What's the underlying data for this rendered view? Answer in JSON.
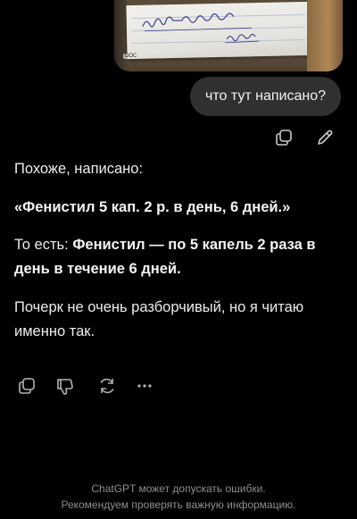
{
  "attachment": {
    "type": "image",
    "handwriting": [
      "Фенистил 5 кап 2 р. в день",
      "6 дней"
    ],
    "badge": "DOC"
  },
  "user_message": {
    "text": "что тут написано?"
  },
  "user_actions": [
    {
      "icon": "copy-icon"
    },
    {
      "icon": "edit-icon"
    }
  ],
  "assistant_message": {
    "intro": "Похоже, написано:",
    "quote": "«Фенистил 5 кап. 2 р. в день, 6 дней.»",
    "explanation_prefix": "То есть: ",
    "explanation_bold": "Фенистил — по 5 капель 2 раза в день в течение 6 дней.",
    "note": "Почерк не очень разборчивый, но я читаю именно так."
  },
  "assistant_actions": [
    {
      "icon": "copy-icon"
    },
    {
      "icon": "thumbs-down-icon"
    },
    {
      "icon": "regenerate-icon"
    },
    {
      "icon": "more-icon"
    }
  ],
  "footer": {
    "line1": "ChatGPT может допускать ошибки.",
    "line2": "Рекомендуем проверять важную информацию."
  }
}
